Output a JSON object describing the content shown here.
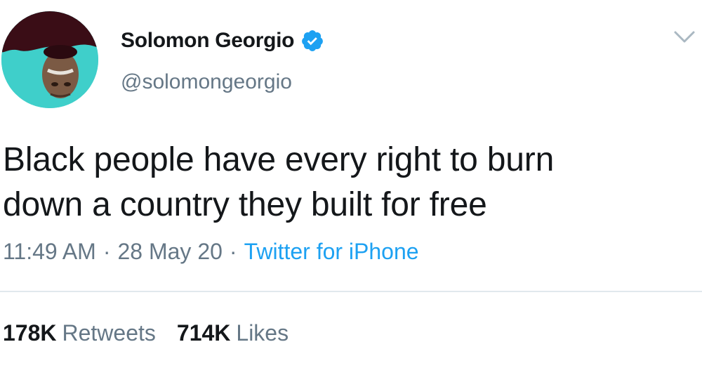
{
  "user": {
    "display_name": "Solomon Georgio",
    "handle": "@solomongeorgio",
    "verified_icon": "verified-badge-icon",
    "avatar_icon": "profile-photo"
  },
  "tweet": {
    "text_line1": "Black people have every right to burn",
    "text_line2": "down a country they built for free"
  },
  "meta": {
    "time": "11:49 AM",
    "separator": "·",
    "date": "28 May 20",
    "source": "Twitter for iPhone"
  },
  "stats": {
    "retweets_count": "178K",
    "retweets_label": "Retweets",
    "likes_count": "714K",
    "likes_label": "Likes"
  },
  "colors": {
    "text": "#14171a",
    "secondary": "#657786",
    "accent": "#1da1f2",
    "divider": "#e1e8ed",
    "avatar_bg": "#3fcfca"
  }
}
